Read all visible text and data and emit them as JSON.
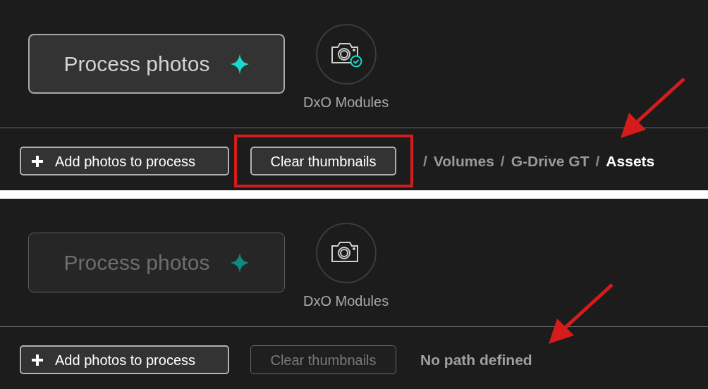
{
  "panels": [
    {
      "process_button": {
        "label": "Process photos",
        "disabled": false
      },
      "modules": {
        "label": "DxO Modules",
        "verified": true
      },
      "add_button": {
        "label": "Add photos to process"
      },
      "clear_button": {
        "label": "Clear thumbnails",
        "disabled": false,
        "highlighted": true
      },
      "path": {
        "kind": "breadcrumb",
        "separator": "/",
        "segments": [
          {
            "label": "Volumes",
            "current": false
          },
          {
            "label": "G-Drive GT",
            "current": false
          },
          {
            "label": "Assets",
            "current": true
          }
        ]
      },
      "annotations": [
        {
          "kind": "arrow"
        }
      ]
    },
    {
      "process_button": {
        "label": "Process photos",
        "disabled": true
      },
      "modules": {
        "label": "DxO Modules",
        "verified": false
      },
      "add_button": {
        "label": "Add photos to process"
      },
      "clear_button": {
        "label": "Clear thumbnails",
        "disabled": true,
        "highlighted": false
      },
      "path": {
        "kind": "message",
        "text": "No path defined"
      },
      "annotations": [
        {
          "kind": "arrow"
        }
      ]
    }
  ]
}
